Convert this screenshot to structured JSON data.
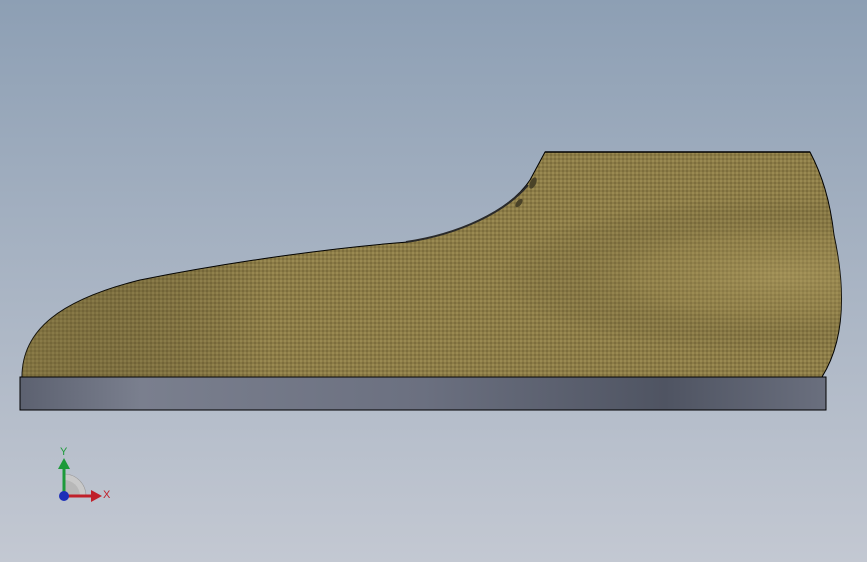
{
  "viewport": {
    "background_top": "#8d9fb4",
    "background_bottom": "#c3c8d2"
  },
  "model": {
    "upper_color": "#8a7a45",
    "upper_highlight": "#a8965a",
    "sole_color": "#555a68",
    "outline_color": "#000000"
  },
  "triad": {
    "x_label": "X",
    "y_label": "Y",
    "x_color": "#c0202a",
    "y_color": "#1d9a3a",
    "z_color": "#1c2fb8"
  }
}
